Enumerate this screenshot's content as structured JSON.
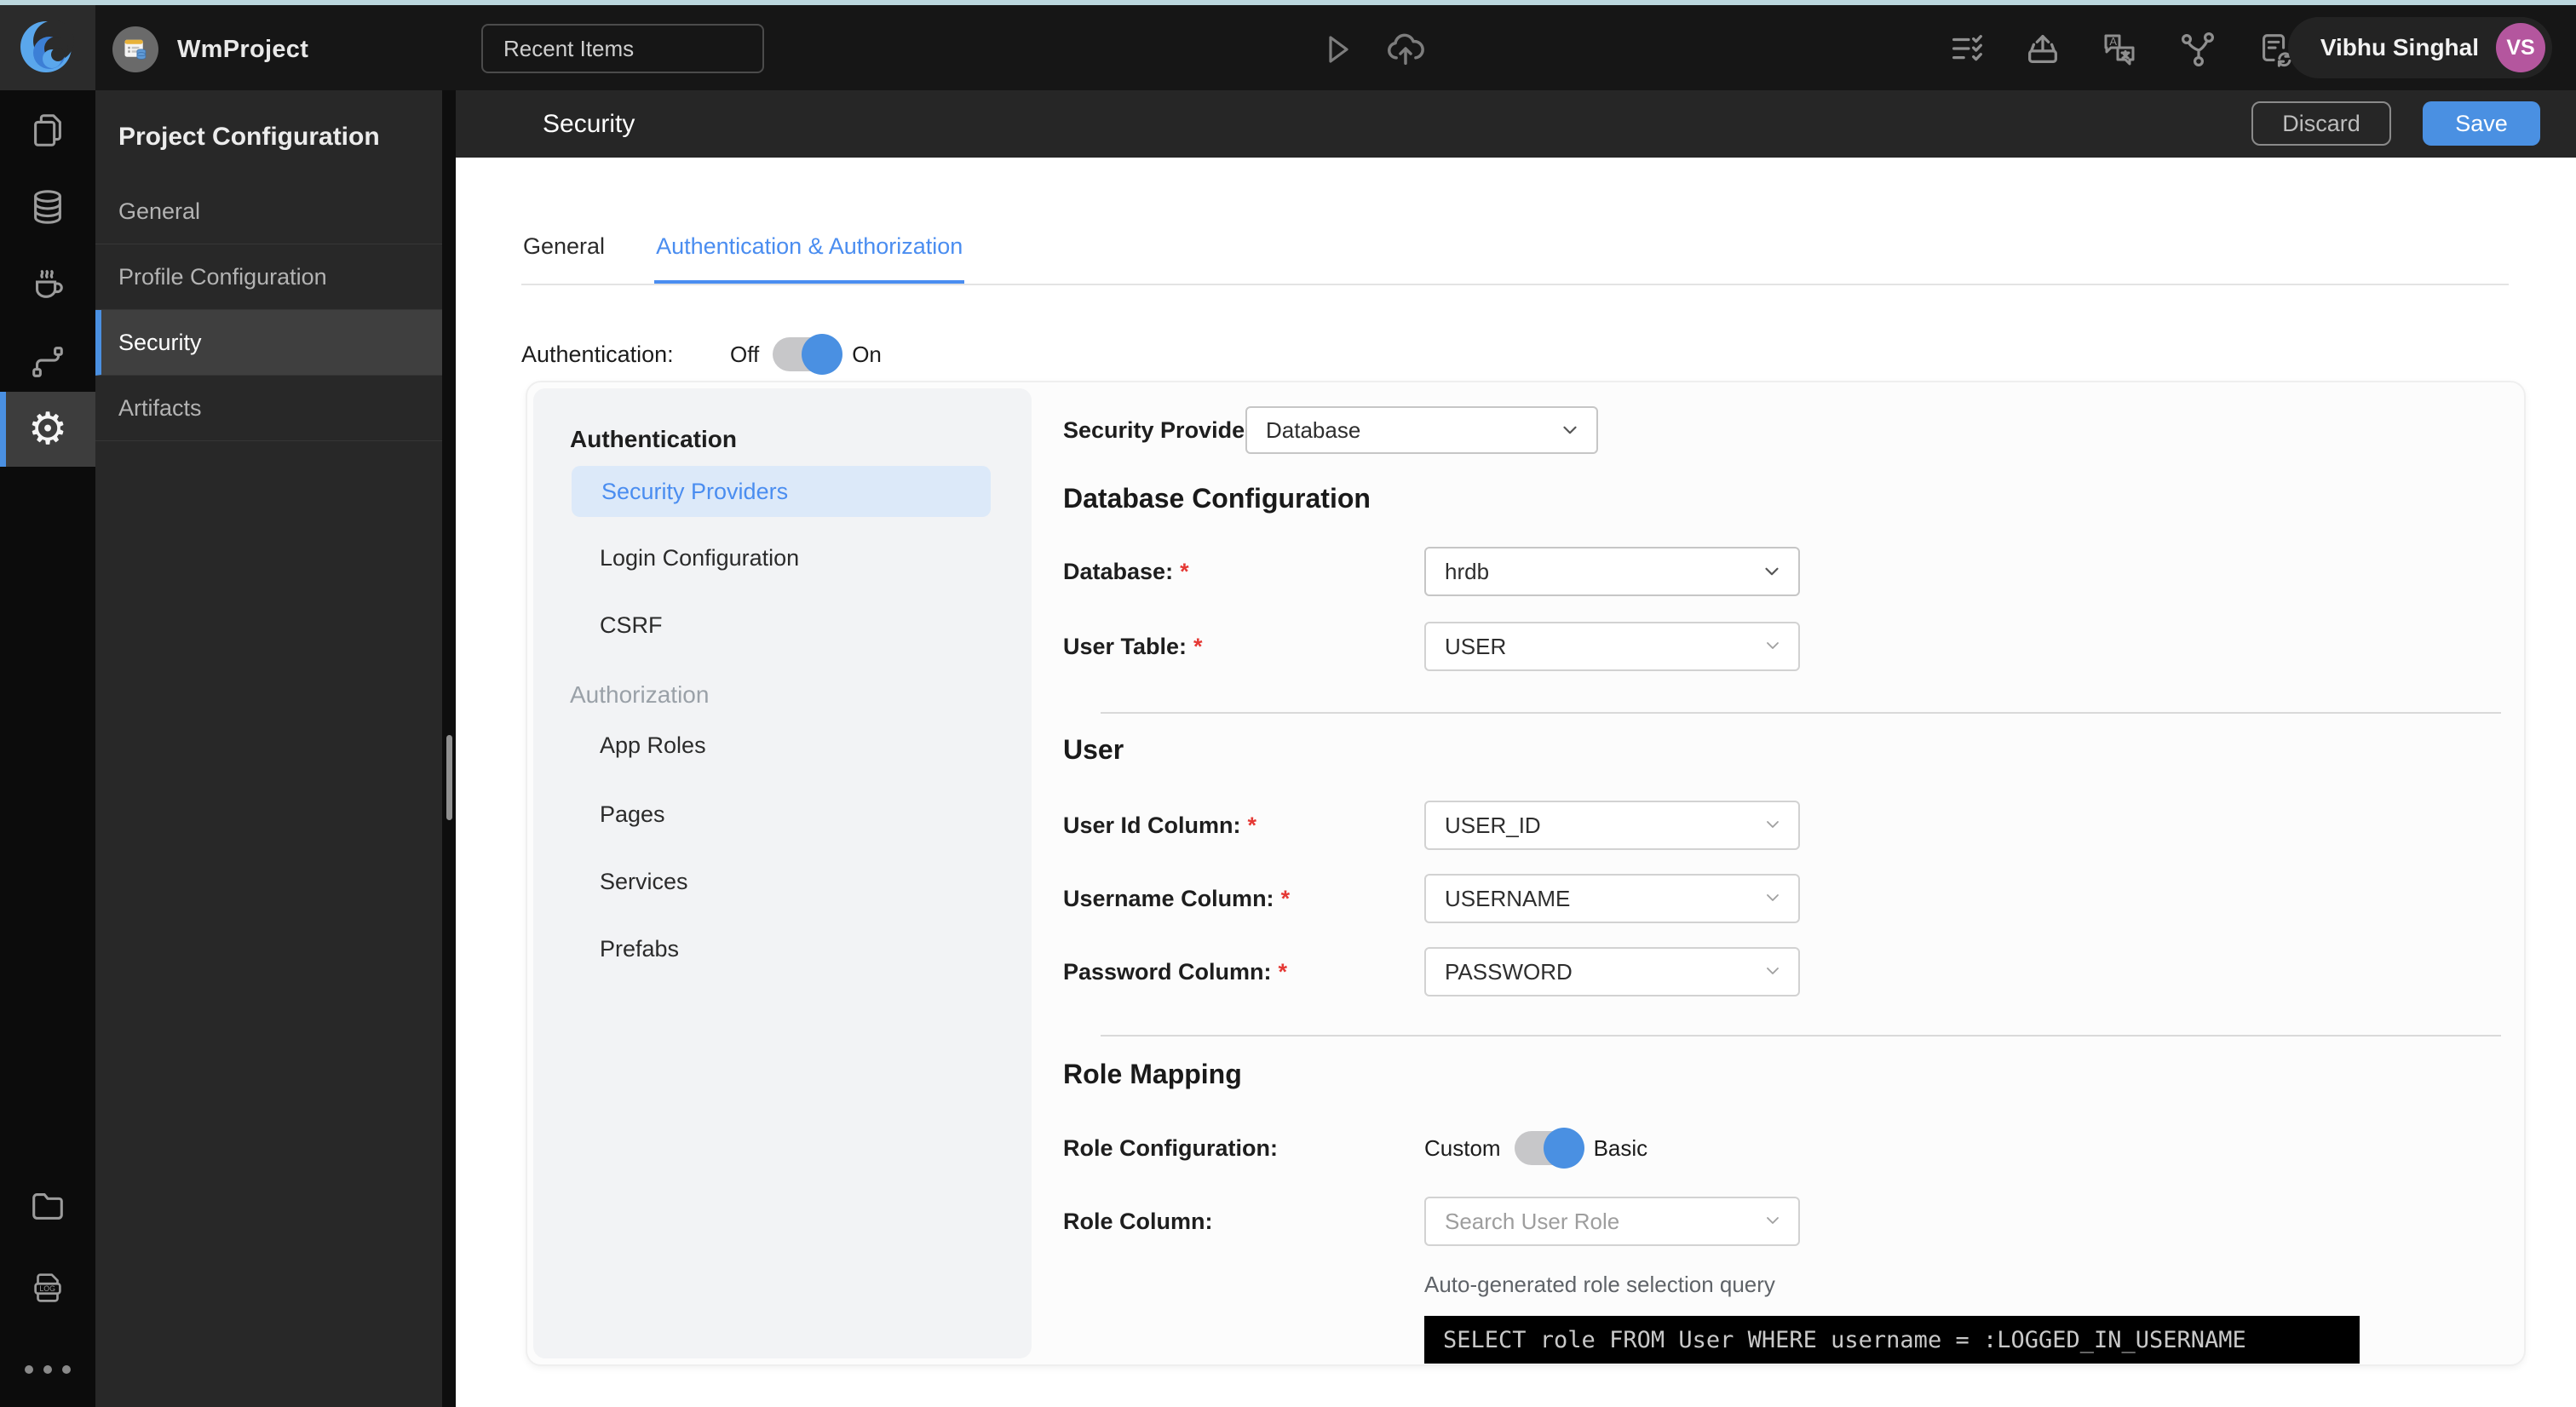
{
  "topbar": {
    "project_name": "WmProject",
    "recent_items_label": "Recent Items",
    "user_name": "Vibhu Singhal",
    "user_initials": "VS"
  },
  "rail": {
    "log_label": "LOG"
  },
  "project_nav": {
    "title": "Project Configuration",
    "items": [
      {
        "label": "General"
      },
      {
        "label": "Profile Configuration"
      },
      {
        "label": "Security"
      },
      {
        "label": "Artifacts"
      }
    ],
    "active_item": "Security"
  },
  "page": {
    "title": "Security",
    "discard_label": "Discard",
    "save_label": "Save"
  },
  "tabs": [
    {
      "label": "General"
    },
    {
      "label": "Authentication & Authorization"
    }
  ],
  "active_tab": "Authentication & Authorization",
  "auth_toggle": {
    "label": "Authentication:",
    "off": "Off",
    "on": "On",
    "value": "On"
  },
  "subnav": {
    "auth_heading": "Authentication",
    "authz_heading": "Authorization",
    "items_auth": [
      "Security Providers",
      "Login Configuration",
      "CSRF"
    ],
    "items_authz": [
      "App Roles",
      "Pages",
      "Services",
      "Prefabs"
    ],
    "active_item": "Security Providers"
  },
  "form": {
    "required_marker": "*",
    "security_provider_label": "Security Provider",
    "security_provider_value": "Database",
    "db_section_title": "Database Configuration",
    "database_label": "Database:",
    "database_value": "hrdb",
    "user_table_label": "User Table:",
    "user_table_value": "USER",
    "user_section_title": "User",
    "user_id_label": "User Id Column:",
    "user_id_value": "USER_ID",
    "username_label": "Username Column:",
    "username_value": "USERNAME",
    "password_label": "Password Column:",
    "password_value": "PASSWORD",
    "role_section_title": "Role Mapping",
    "role_config_label": "Role Configuration:",
    "role_custom_label": "Custom",
    "role_basic_label": "Basic",
    "role_config_value": "Basic",
    "role_column_label": "Role Column:",
    "role_column_placeholder": "Search User Role",
    "query_caption": "Auto-generated role selection query",
    "query_sql": "SELECT role FROM User WHERE username = :LOGGED_IN_USERNAME"
  },
  "colors": {
    "accent_blue": "#4a90e2",
    "tab_blue": "#4a8df0",
    "top_strip": "#bcd7de",
    "avatar_purple": "#b4569e",
    "header_dark": "#262626",
    "rail_dark": "#0c0c0c",
    "panel_dark": "#282828"
  }
}
